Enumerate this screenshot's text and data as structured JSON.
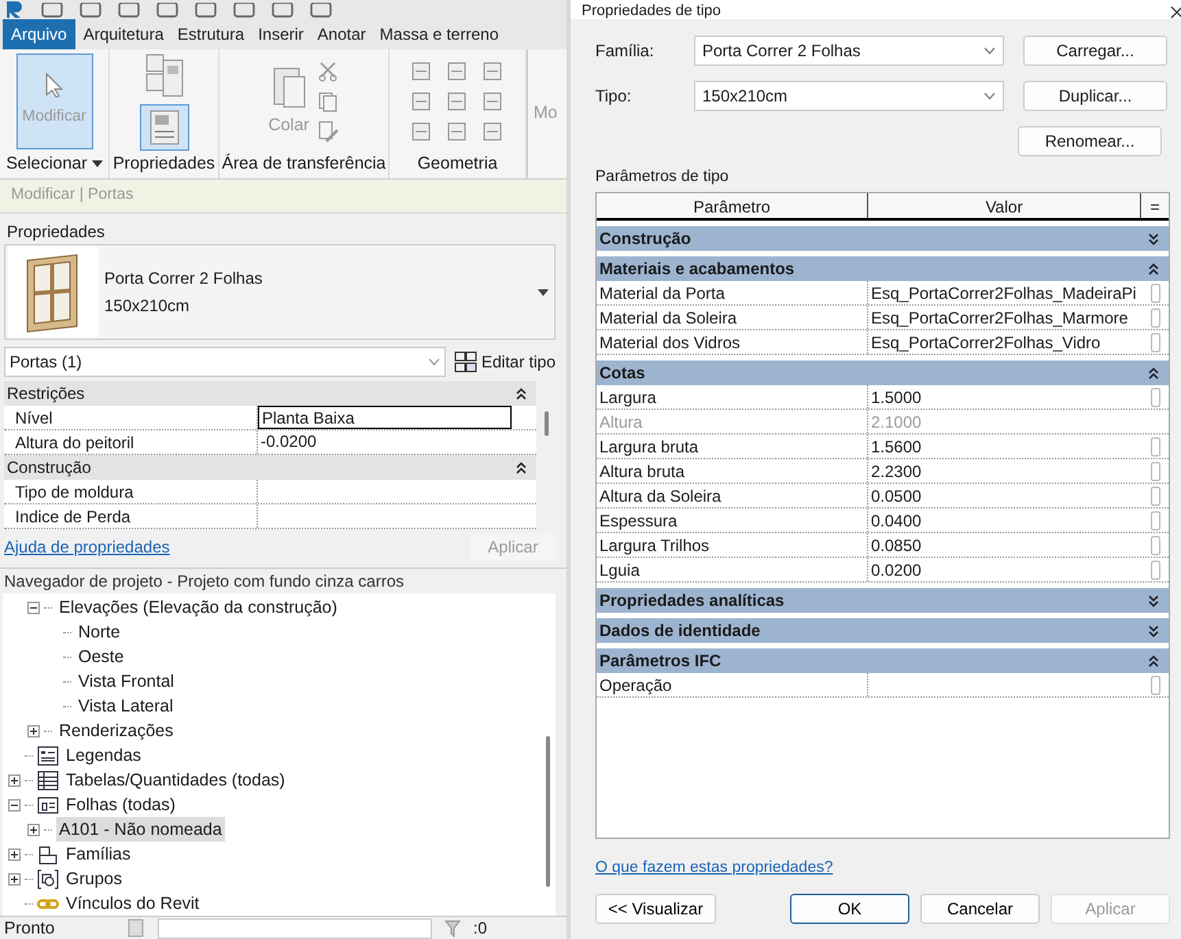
{
  "ribbon": {
    "tabs": [
      {
        "label": "Arquivo",
        "selected": true
      },
      {
        "label": "Arquitetura",
        "selected": false
      },
      {
        "label": "Estrutura",
        "selected": false
      },
      {
        "label": "Inserir",
        "selected": false
      },
      {
        "label": "Anotar",
        "selected": false
      },
      {
        "label": "Massa e terreno",
        "selected": false
      }
    ],
    "modify_button": {
      "label": "Modificar",
      "selected": true
    },
    "properties_button": {
      "selected": true
    },
    "paste_label": "Colar",
    "cut_off_button": "Mo",
    "panels": [
      {
        "label": "Selecionar",
        "dropdown": true
      },
      {
        "label": "Propriedades",
        "dropdown": false
      },
      {
        "label": "Área de transferência",
        "dropdown": false
      },
      {
        "label": "Geometria",
        "dropdown": false
      }
    ]
  },
  "context_bar": "Modificar | Portas",
  "properties": {
    "title": "Propriedades",
    "type_name": "Porta Correr 2 Folhas",
    "type_size": "150x210cm",
    "filter": "Portas (1)",
    "edit_type": "Editar tipo",
    "groups": [
      {
        "label": "Restrições",
        "expanded": true,
        "rows": [
          {
            "name": "Nível",
            "value": "Planta Baixa",
            "editing": true
          },
          {
            "name": "Altura do peitoril",
            "value": "-0.0200",
            "editing": false
          }
        ]
      },
      {
        "label": "Construção",
        "expanded": true,
        "rows": [
          {
            "name": "Tipo de moldura",
            "editing": false
          },
          {
            "name": "Indice de Perda",
            "editing": false
          }
        ]
      }
    ],
    "help_link": "Ajuda de propriedades",
    "apply": {
      "label": "Aplicar",
      "disabled": true
    }
  },
  "project_browser": {
    "title": "Navegador de projeto - Projeto com fundo cinza carros",
    "items": [
      {
        "children": [
          {
            "label": "Elevações (Elevação da construção)",
            "expanded": true,
            "selected": false,
            "children": [
              {
                "label": "Norte",
                "selected": false
              },
              {
                "label": "Oeste",
                "selected": false
              },
              {
                "label": "Vista Frontal",
                "selected": false
              },
              {
                "label": "Vista Lateral",
                "selected": false
              }
            ]
          },
          {
            "label": "Renderizações",
            "expanded": false,
            "selected": false
          }
        ]
      },
      {
        "label": "Legendas",
        "kind": "legend",
        "selected": false
      },
      {
        "label": "Tabelas/Quantidades (todas)",
        "kind": "schedule",
        "expanded": false,
        "selected": false
      },
      {
        "label": "Folhas (todas)",
        "kind": "sheet",
        "expanded": true,
        "selected": false,
        "children": [
          {
            "label": "A101 - Não nomeada",
            "expanded": false,
            "selected": true
          }
        ]
      },
      {
        "label": "Famílias",
        "kind": "family",
        "expanded": false,
        "selected": false
      },
      {
        "label": "Grupos",
        "kind": "group",
        "expanded": false,
        "selected": false
      },
      {
        "label": "Vínculos do Revit",
        "kind": "link",
        "selected": false
      }
    ]
  },
  "status_bar": {
    "text": "Pronto",
    "count": ":0"
  },
  "dialog": {
    "title": "Propriedades de tipo",
    "family_label": "Família:",
    "family_value": "Porta Correr 2 Folhas",
    "type_label": "Tipo:",
    "type_value": "150x210cm",
    "side_buttons": [
      "Carregar...",
      "Duplicar...",
      "Renomear..."
    ],
    "params_label": "Parâmetros de tipo",
    "columns": [
      "Parâmetro",
      "Valor",
      "="
    ],
    "groups": [
      {
        "label": "Construção",
        "expanded": false
      },
      {
        "label": "Materiais e acabamentos",
        "expanded": true,
        "rows": [
          {
            "name": "Material da Porta",
            "value": "Esq_PortaCorrer2Folhas_MadeiraPi",
            "disabled": false
          },
          {
            "name": "Material da Soleira",
            "value": "Esq_PortaCorrer2Folhas_Marmore",
            "disabled": false
          },
          {
            "name": "Material dos Vidros",
            "value": "Esq_PortaCorrer2Folhas_Vidro",
            "disabled": false
          }
        ]
      },
      {
        "label": "Cotas",
        "expanded": true,
        "rows": [
          {
            "name": "Largura",
            "value": "1.5000",
            "disabled": false
          },
          {
            "name": "Altura",
            "value": "2.1000",
            "disabled": true
          },
          {
            "name": "Largura bruta",
            "value": "1.5600",
            "disabled": false
          },
          {
            "name": "Altura bruta",
            "value": "2.2300",
            "disabled": false
          },
          {
            "name": "Altura da Soleira",
            "value": "0.0500",
            "disabled": false
          },
          {
            "name": "Espessura",
            "value": "0.0400",
            "disabled": false
          },
          {
            "name": "Largura Trilhos",
            "value": "0.0850",
            "disabled": false
          },
          {
            "name": "Lguia",
            "value": "0.0200",
            "disabled": false
          }
        ]
      },
      {
        "label": "Propriedades analíticas",
        "expanded": false
      },
      {
        "label": "Dados de identidade",
        "expanded": false
      },
      {
        "label": "Parâmetros IFC",
        "expanded": true,
        "rows": [
          {
            "name": "Operação",
            "disabled": false
          }
        ]
      }
    ],
    "help_link": "O que fazem estas propriedades?",
    "footer_buttons": [
      {
        "label": "<< Visualizar",
        "default": false,
        "disabled": false
      },
      {
        "label": "OK",
        "default": true,
        "disabled": false
      },
      {
        "label": "Cancelar",
        "default": false,
        "disabled": false
      },
      {
        "label": "Aplicar",
        "default": false,
        "disabled": true
      }
    ]
  }
}
